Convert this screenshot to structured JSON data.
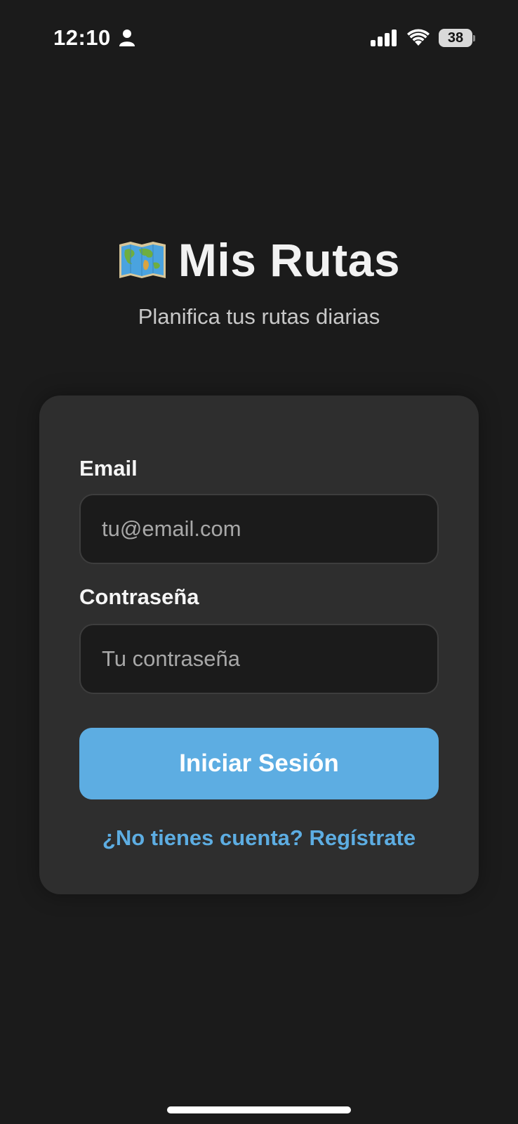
{
  "status_bar": {
    "time": "12:10",
    "battery": "38"
  },
  "header": {
    "title": "Mis Rutas",
    "subtitle": "Planifica tus rutas diarias",
    "icon": "world-map-icon"
  },
  "form": {
    "email_label": "Email",
    "email_placeholder": "tu@email.com",
    "email_value": "",
    "password_label": "Contraseña",
    "password_placeholder": "Tu contraseña",
    "password_value": "",
    "login_button": "Iniciar Sesión",
    "register_link": "¿No tienes cuenta? Regístrate"
  },
  "colors": {
    "background": "#1b1b1b",
    "card": "#2e2e2e",
    "accent": "#5dade2",
    "text": "#f2f2f2"
  }
}
